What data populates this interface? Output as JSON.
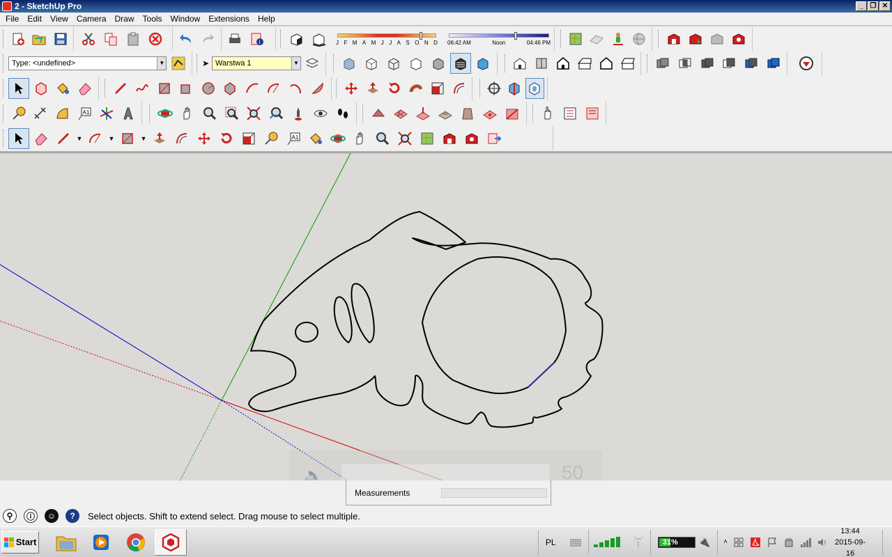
{
  "window": {
    "title": "2 - SketchUp Pro",
    "controls": [
      "_",
      "❐",
      "✕"
    ]
  },
  "menu": [
    "File",
    "Edit",
    "View",
    "Camera",
    "Draw",
    "Tools",
    "Window",
    "Extensions",
    "Help"
  ],
  "shadows": {
    "months": [
      "J",
      "F",
      "M",
      "A",
      "M",
      "J",
      "J",
      "A",
      "S",
      "O",
      "N",
      "D"
    ],
    "time_start": "06:42 AM",
    "time_mid": "Noon",
    "time_end": "04:46 PM"
  },
  "entity_info": {
    "type_value": "Type: <undefined>"
  },
  "layer": {
    "current": "Warstwa 1"
  },
  "measurements": {
    "label": "Measurements",
    "value": ""
  },
  "volume_overlay": {
    "level": "50"
  },
  "status": {
    "hint": "Select objects. Shift to extend select. Drag mouse to select multiple."
  },
  "taskbar": {
    "start_label": "Start",
    "language": "PL",
    "battery": "31%",
    "battery_level": 0.31,
    "time": "13:44",
    "date": "2015-09-16"
  },
  "colors": {
    "axis_red": "#cc0000",
    "axis_green": "#00a000",
    "axis_blue": "#0000cc",
    "viewport_bg": "#dcdad6"
  }
}
